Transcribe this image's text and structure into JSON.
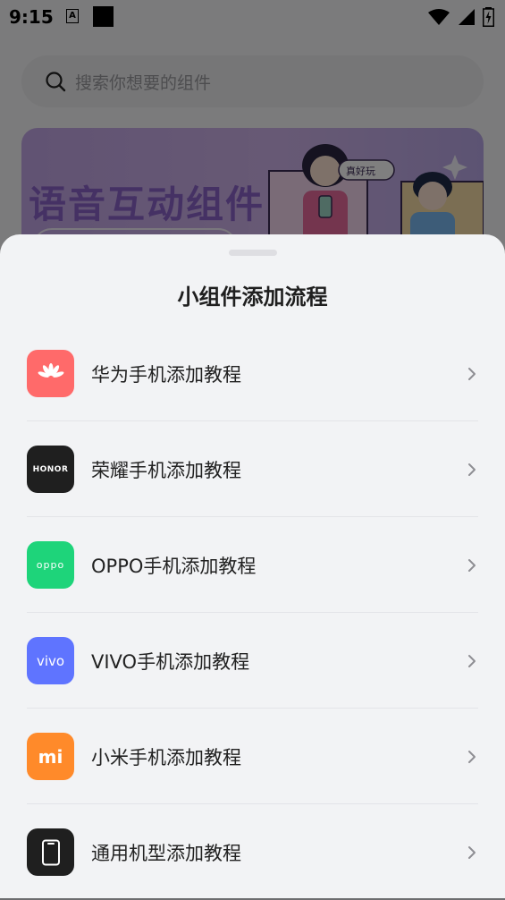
{
  "status": {
    "time": "9:15",
    "a_icon_text": "A"
  },
  "search": {
    "placeholder": "搜索你想要的组件"
  },
  "banner": {
    "title": "语音互动组件",
    "bubble_text": "真好玩"
  },
  "sheet": {
    "title": "小组件添加流程",
    "items": [
      {
        "label": "华为手机添加教程",
        "icon": "huawei-logo-icon",
        "color": "#ff6a6a"
      },
      {
        "label": "荣耀手机添加教程",
        "icon": "honor-logo-icon",
        "color": "#1f1f1f",
        "logo_text": "HONOR"
      },
      {
        "label": "OPPO手机添加教程",
        "icon": "oppo-logo-icon",
        "color": "#1ed47a",
        "logo_text": "oppo"
      },
      {
        "label": "VIVO手机添加教程",
        "icon": "vivo-logo-icon",
        "color": "#5f74ff",
        "logo_text": "vivo"
      },
      {
        "label": "小米手机添加教程",
        "icon": "xiaomi-logo-icon",
        "color": "#ff8a2a",
        "logo_text": "mi"
      },
      {
        "label": "通用机型添加教程",
        "icon": "phone-icon",
        "color": "#1f1f1f"
      }
    ]
  }
}
